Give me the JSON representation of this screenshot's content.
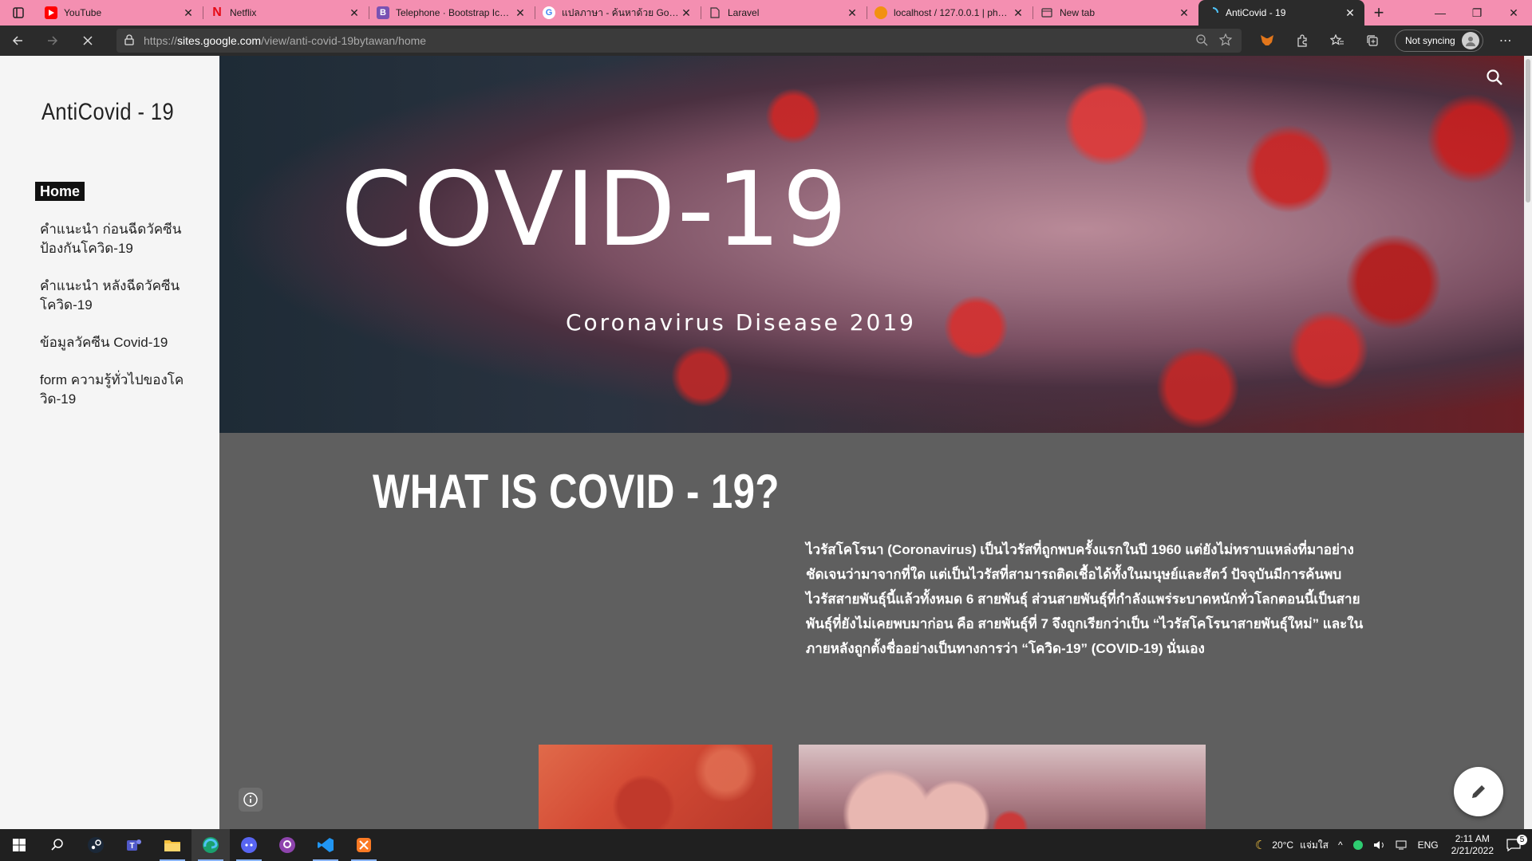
{
  "browser": {
    "tabs": [
      {
        "title": "YouTube",
        "favicon": "youtube-icon",
        "color": "#ff0000"
      },
      {
        "title": "Netflix",
        "favicon": "netflix-icon",
        "color": "#e50914"
      },
      {
        "title": "Telephone · Bootstrap Icons",
        "favicon": "bootstrap-icon",
        "color": "#7952b3"
      },
      {
        "title": "แปลภาษา - ค้นหาด้วย Google",
        "favicon": "google-icon",
        "color": "#4285f4"
      },
      {
        "title": "Laravel",
        "favicon": "page-icon",
        "color": "#888888"
      },
      {
        "title": "localhost / 127.0.0.1 | phpMyAdmin",
        "favicon": "phpmyadmin-icon",
        "color": "#f29111"
      },
      {
        "title": "New tab",
        "favicon": "newtab-icon",
        "color": "#444444"
      },
      {
        "title": "AntiCovid - 19",
        "favicon": "loading-icon",
        "color": "#4fc3f7"
      }
    ],
    "url_scheme": "https://",
    "url_host": "sites.google.com",
    "url_path": "/view/anti-covid-19bytawan/home",
    "sync_label": "Not syncing",
    "tabstrip_color": "#f48fb1"
  },
  "site": {
    "title": "AntiCovid - 19",
    "nav": [
      {
        "label": "Home",
        "active": true
      },
      {
        "label": "คำแนะนำ ก่อนฉีดวัคซีนป้องกันโควิด-19",
        "active": false
      },
      {
        "label": "คำแนะนำ หลังฉีดวัคซีนโควิด-19",
        "active": false
      },
      {
        "label": "ข้อมูลวัคซีน Covid-19",
        "active": false
      },
      {
        "label": "form ความรู้ทั่วไปของโควิด-19",
        "active": false
      }
    ],
    "hero_title": "COVID-19",
    "hero_subtitle": "Coronavirus Disease 2019",
    "section_title": "WHAT IS COVID - 19?",
    "section_text": "ไวรัสโคโรนา (Coronavirus) เป็นไวรัสที่ถูกพบครั้งแรกในปี 1960 แต่ยังไม่ทราบแหล่งที่มาอย่างชัดเจนว่ามาจากที่ใด แต่เป็นไวรัสที่สามารถติดเชื้อได้ทั้งในมนุษย์และสัตว์ ปัจจุบันมีการค้นพบไวรัสสายพันธุ์นี้แล้วทั้งหมด 6 สายพันธุ์ ส่วนสายพันธุ์ที่กำลังแพร่ระบาดหนักทั่วโลกตอนนี้เป็นสายพันธุ์ที่ยังไม่เคยพบมาก่อน คือ สายพันธุ์ที่ 7 จึงถูกเรียกว่าเป็น “ไวรัสโคโรนาสายพันธุ์ใหม่” และในภายหลังถูกตั้งชื่ออย่างเป็นทางการว่า “โควิด-19” (COVID-19) นั่นเอง"
  },
  "taskbar": {
    "apps": [
      "windows-start-icon",
      "search-icon",
      "steam-icon",
      "teams-icon",
      "file-explorer-icon",
      "edge-icon",
      "discord-icon",
      "github-icon",
      "vscode-icon",
      "xampp-icon"
    ],
    "weather": "20°C",
    "weather_label": "แจ่มใส",
    "language": "ENG",
    "time": "2:11 AM",
    "date": "2/21/2022",
    "notifications": "5"
  }
}
